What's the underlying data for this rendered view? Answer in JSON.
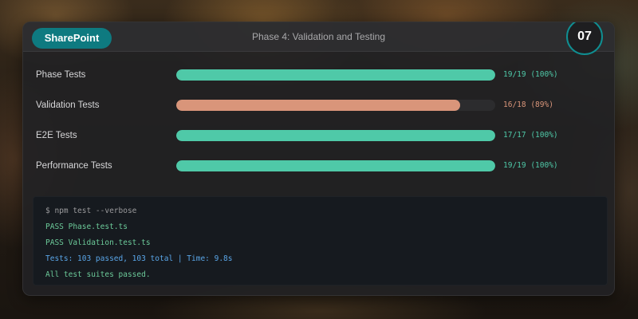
{
  "header": {
    "brand": "SharePoint",
    "title": "Phase 4: Validation and Testing",
    "slide_number": "07"
  },
  "colors": {
    "accent": "#0e7a80",
    "pass": "#4fc9a8",
    "warn": "#d9957a",
    "track": "#2c2c2e",
    "terminal_bg": "#161a1f",
    "cmd": "#9a9a9c",
    "pass_text": "#6ccb9a",
    "info_text": "#5aa6e8"
  },
  "tests": [
    {
      "label": "Phase Tests",
      "passed": 19,
      "total": 19,
      "percent": 100,
      "value_text": "19/19 (100%)",
      "status": "pass"
    },
    {
      "label": "Validation Tests",
      "passed": 16,
      "total": 18,
      "percent": 89,
      "value_text": "16/18 (89%)",
      "status": "warn"
    },
    {
      "label": "E2E Tests",
      "passed": 17,
      "total": 17,
      "percent": 100,
      "value_text": "17/17 (100%)",
      "status": "pass"
    },
    {
      "label": "Performance Tests",
      "passed": 19,
      "total": 19,
      "percent": 100,
      "value_text": "19/19 (100%)",
      "status": "pass"
    }
  ],
  "terminal": {
    "lines": [
      {
        "text": "$ npm test --verbose",
        "kind": "cmd"
      },
      {
        "text": "PASS Phase.test.ts",
        "kind": "pass"
      },
      {
        "text": "PASS Validation.test.ts",
        "kind": "pass"
      },
      {
        "text": "Tests: 103 passed, 103 total | Time: 9.8s",
        "kind": "info"
      },
      {
        "text": "All test suites passed.",
        "kind": "pass"
      }
    ]
  }
}
